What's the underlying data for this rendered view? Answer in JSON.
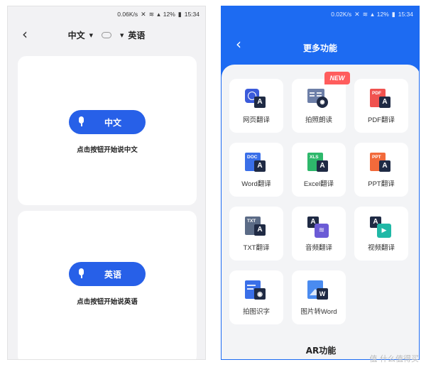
{
  "left": {
    "status_bar": {
      "speed": "0.06K/s",
      "battery": "12%",
      "time": "15:34"
    },
    "source_lang": "中文",
    "target_lang": "英语",
    "card1": {
      "button_label": "中文",
      "hint": "点击按钮开始说中文"
    },
    "card2": {
      "button_label": "英语",
      "hint": "点击按钮开始说英语"
    }
  },
  "right": {
    "status_bar": {
      "speed": "0.02K/s",
      "battery": "12%",
      "time": "15:34"
    },
    "title": "更多功能",
    "new_badge": "NEW",
    "tiles": [
      {
        "label": "网页翻译",
        "icon": "web-translate-icon"
      },
      {
        "label": "拍照朗读",
        "icon": "photo-read-icon"
      },
      {
        "label": "PDF翻译",
        "icon": "pdf-translate-icon",
        "tag": "PDF"
      },
      {
        "label": "Word翻译",
        "icon": "word-translate-icon",
        "tag": "DOC"
      },
      {
        "label": "Excel翻译",
        "icon": "excel-translate-icon",
        "tag": "XLS"
      },
      {
        "label": "PPT翻译",
        "icon": "ppt-translate-icon",
        "tag": "PPT"
      },
      {
        "label": "TXT翻译",
        "icon": "txt-translate-icon",
        "tag": "TXT"
      },
      {
        "label": "音频翻译",
        "icon": "audio-translate-icon"
      },
      {
        "label": "视频翻译",
        "icon": "video-translate-icon"
      },
      {
        "label": "拍图识字",
        "icon": "photo-ocr-icon"
      },
      {
        "label": "图片转Word",
        "icon": "image-to-word-icon"
      }
    ],
    "section_title": "AR功能"
  },
  "watermark": "值 什么值得买",
  "colors": {
    "brand_blue": "#2760e8",
    "header_blue": "#1d6bf2",
    "new_red": "#ff5d5d"
  }
}
